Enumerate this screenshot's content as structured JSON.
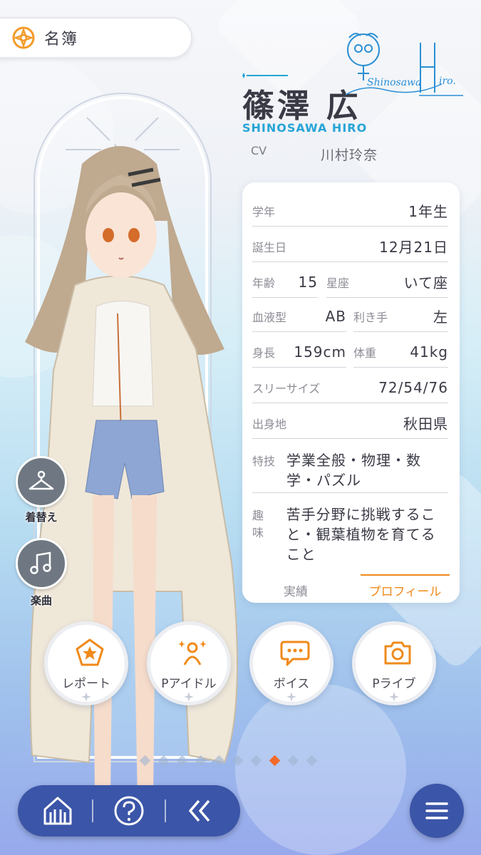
{
  "header": {
    "back_label": "名簿",
    "icon": "compass-icon"
  },
  "character": {
    "name": "篠澤 広",
    "romaji": "SHINOSAWA HIRO",
    "cv_label": "CV",
    "cv_name": "川村玲奈"
  },
  "profile": {
    "grade": {
      "label": "学年",
      "value": "1年生"
    },
    "birthday": {
      "label": "誕生日",
      "value": "12月21日"
    },
    "age": {
      "label": "年齢",
      "value": "15"
    },
    "zodiac": {
      "label": "星座",
      "value": "いて座"
    },
    "blood": {
      "label": "血液型",
      "value": "AB"
    },
    "hand": {
      "label": "利き手",
      "value": "左"
    },
    "height": {
      "label": "身長",
      "value": "159cm"
    },
    "weight": {
      "label": "体重",
      "value": "41kg"
    },
    "sizes": {
      "label": "スリーサイズ",
      "value": "72/54/76"
    },
    "hometown": {
      "label": "出身地",
      "value": "秋田県"
    },
    "skill": {
      "label": "特技",
      "value": "学業全般・物理・数学・パズル"
    },
    "hobby": {
      "label": "趣味",
      "value": "苦手分野に挑戦すること・観葉植物を育てること"
    }
  },
  "tabs": {
    "record": "実績",
    "profile": "プロフィール",
    "active": "profile"
  },
  "side": {
    "outfit": "着替え",
    "music": "楽曲"
  },
  "actions": [
    {
      "label": "レポート",
      "icon": "pentagon-star-icon"
    },
    {
      "label": "Pアイドル",
      "icon": "idol-sparkle-icon"
    },
    {
      "label": "ボイス",
      "icon": "speech-bubble-icon"
    },
    {
      "label": "Pライブ",
      "icon": "camera-icon"
    }
  ],
  "pager": {
    "total": 10,
    "active_index": 7
  },
  "colors": {
    "accent": "#f08a1a",
    "romaji": "#27a4d6",
    "nav": "#3b55a8"
  }
}
